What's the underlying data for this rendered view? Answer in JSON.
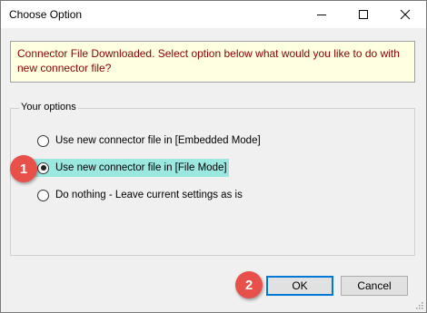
{
  "window": {
    "title": "Choose Option",
    "controls": {
      "minimize": "minimize-icon",
      "maximize": "maximize-icon",
      "close": "close-icon"
    }
  },
  "info": {
    "message": "Connector File Downloaded. Select option below what would you like to do with new connector file?"
  },
  "options_group": {
    "label": "Your options",
    "options": [
      {
        "label": "Use new connector file in [Embedded Mode]",
        "selected": false
      },
      {
        "label": "Use new connector file in [File Mode]",
        "selected": true
      },
      {
        "label": "Do nothing - Leave current settings as is",
        "selected": false
      }
    ]
  },
  "callouts": {
    "first": "1",
    "second": "2"
  },
  "buttons": {
    "ok": "OK",
    "cancel": "Cancel"
  },
  "colors": {
    "info_background": "#ffffe1",
    "info_text": "#8b0000",
    "highlight": "#9be8e0",
    "callout": "#e8504a",
    "default_button_border": "#0078d7"
  }
}
